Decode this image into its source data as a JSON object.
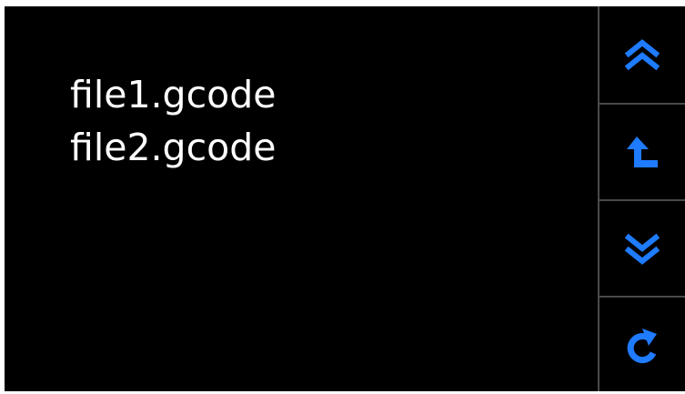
{
  "files": [
    {
      "name": "file1.gcode"
    },
    {
      "name": "file2.gcode"
    }
  ],
  "toolbar": {
    "accent_color": "#1f7bff",
    "buttons": [
      {
        "icon": "double-chevron-up-icon",
        "action": "page-up"
      },
      {
        "icon": "return-up-icon",
        "action": "parent-directory"
      },
      {
        "icon": "double-chevron-down-icon",
        "action": "page-down"
      },
      {
        "icon": "refresh-icon",
        "action": "refresh"
      }
    ]
  }
}
